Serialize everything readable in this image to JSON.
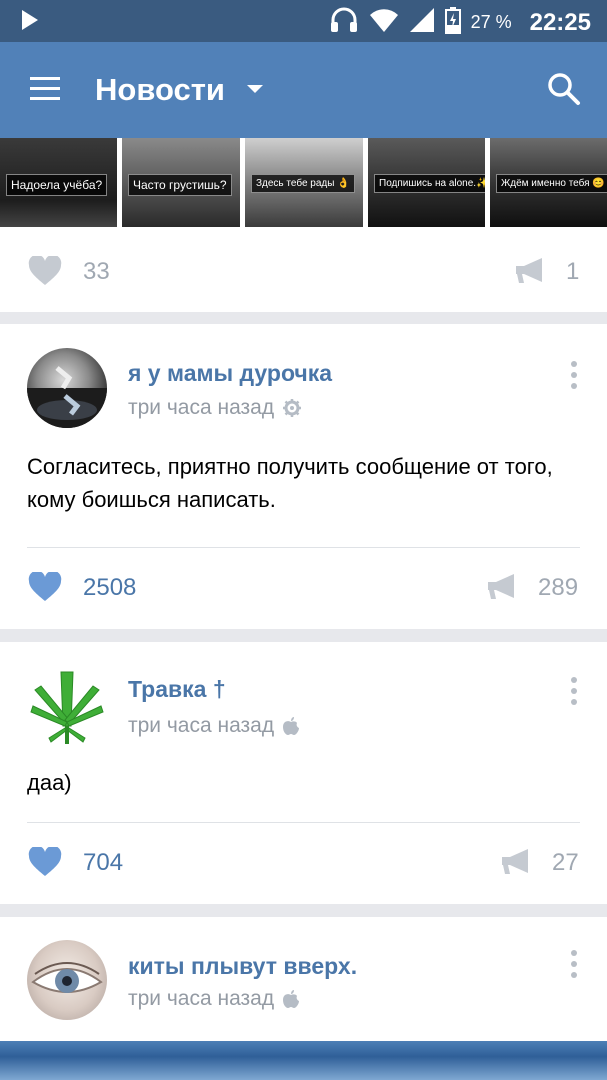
{
  "status_bar": {
    "battery": "27 %",
    "time": "22:25"
  },
  "toolbar": {
    "title": "Новости"
  },
  "photo_post": {
    "thumbnails": [
      {
        "label": "Надоела учёба?"
      },
      {
        "label": "Часто грустишь?"
      },
      {
        "label": "Здесь тебе рады 👌"
      },
      {
        "label": "Подпишись на alone.✨"
      },
      {
        "label": "Ждём именно тебя 😊"
      }
    ],
    "likes": "33",
    "shares": "1"
  },
  "posts": [
    {
      "author": "я у мамы дурочка",
      "time": "три часа назад",
      "text": "Согласитесь, приятно получить сообщение от того, кому боишься написать.",
      "likes": "2508",
      "shares": "289",
      "source_icon": "gear-icon"
    },
    {
      "author": "Травка †",
      "time": "три часа назад",
      "text": "даа)",
      "likes": "704",
      "shares": "27",
      "source_icon": "apple-icon"
    },
    {
      "author": "киты плывут вверх.",
      "time": "три часа назад",
      "source_icon": "apple-icon"
    }
  ],
  "colors": {
    "status_bar": "#3a5b80",
    "toolbar": "#5181b8",
    "accent": "#4a76a8",
    "muted": "#939aa3"
  }
}
